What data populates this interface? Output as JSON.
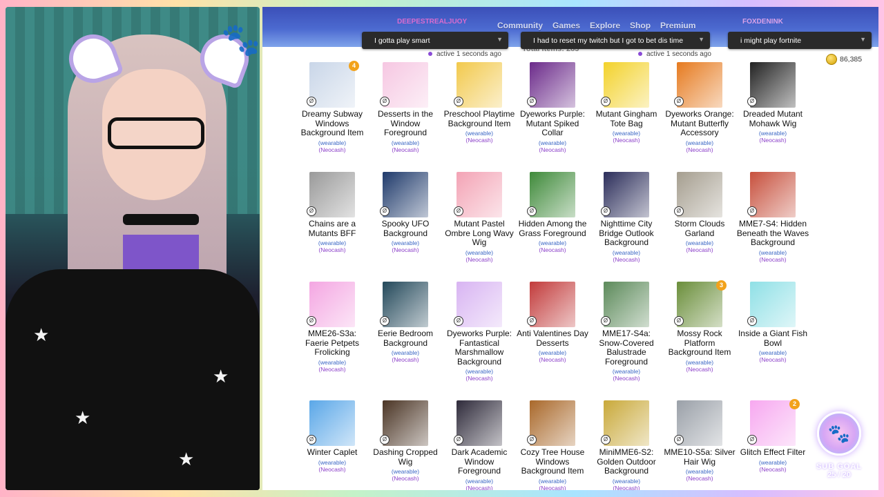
{
  "stream": {
    "chat": [
      {
        "text": "I gotta play smart",
        "active": "active 1 seconds ago"
      },
      {
        "text": "I had to reset my twitch but I got to bet dis time",
        "active": "active 1 seconds ago"
      },
      {
        "text": "i might play fortnite",
        "active": ""
      }
    ],
    "sub_goal": {
      "label": "SUB GOAL",
      "count": "25 / 20"
    }
  },
  "site": {
    "nav": [
      "Community",
      "Games",
      "Explore",
      "Shop",
      "Premium"
    ],
    "users": [
      "DEEPESTREALJUOY",
      "FOXDENINK"
    ],
    "total_items": "Total Items: 283",
    "currency": "86,385"
  },
  "items": [
    {
      "name": "Dreamy Subway Windows Background Item",
      "qty": "4",
      "color": "#c9d6e8"
    },
    {
      "name": "Desserts in the Window Foreground",
      "qty": "",
      "color": "#f6c7e2"
    },
    {
      "name": "Preschool Playtime Background Item",
      "qty": "",
      "color": "#f2c94c"
    },
    {
      "name": "Dyeworks Purple: Mutant Spiked Collar",
      "qty": "",
      "color": "#6b2a8a"
    },
    {
      "name": "Mutant Gingham Tote Bag",
      "qty": "",
      "color": "#f3d22b"
    },
    {
      "name": "Dyeworks Orange: Mutant Butterfly Accessory",
      "qty": "",
      "color": "#e67a1f"
    },
    {
      "name": "Dreaded Mutant Mohawk Wig",
      "qty": "",
      "color": "#222222"
    },
    {
      "name": "Chains are a Mutants BFF",
      "qty": "",
      "color": "#9a9a9a"
    },
    {
      "name": "Spooky UFO Background",
      "qty": "",
      "color": "#1f3a6b"
    },
    {
      "name": "Mutant Pastel Ombre Long Wavy Wig",
      "qty": "",
      "color": "#f3a3b5"
    },
    {
      "name": "Hidden Among the Grass Foreground",
      "qty": "",
      "color": "#3f8a3a"
    },
    {
      "name": "Nighttime City Bridge Outlook Background",
      "qty": "",
      "color": "#2b2d5a"
    },
    {
      "name": "Storm Clouds Garland",
      "qty": "",
      "color": "#a59e8f"
    },
    {
      "name": "MME7-S4: Hidden Beneath the Waves Background",
      "qty": "",
      "color": "#c7503d"
    },
    {
      "name": "MME26-S3a: Faerie Petpets Frolicking",
      "qty": "",
      "color": "#f4a6e2"
    },
    {
      "name": "Eerie Bedroom Background",
      "qty": "",
      "color": "#23485a"
    },
    {
      "name": "Dyeworks Purple: Fantastical Marshmallow Background",
      "qty": "",
      "color": "#d8b4f2"
    },
    {
      "name": "Anti Valentines Day Desserts",
      "qty": "",
      "color": "#c23b3b"
    },
    {
      "name": "MME17-S4a: Snow-Covered Balustrade Foreground",
      "qty": "",
      "color": "#5c8a5a"
    },
    {
      "name": "Mossy Rock Platform Background Item",
      "qty": "3",
      "color": "#6a8e3a"
    },
    {
      "name": "Inside a Giant Fish Bowl",
      "qty": "",
      "color": "#8fe0e6"
    },
    {
      "name": "Winter Caplet",
      "qty": "",
      "color": "#5aa7e8"
    },
    {
      "name": "Dashing Cropped Wig",
      "qty": "",
      "color": "#4a3424"
    },
    {
      "name": "Dark Academic Window Foreground",
      "qty": "",
      "color": "#2e2a3a"
    },
    {
      "name": "Cozy Tree House Windows Background Item",
      "qty": "",
      "color": "#a9682a"
    },
    {
      "name": "MiniMME6-S2: Golden Outdoor Background",
      "qty": "",
      "color": "#c9a93a"
    },
    {
      "name": "MME10-S5a: Silver Hair Wig",
      "qty": "",
      "color": "#9aa0a8"
    },
    {
      "name": "Glitch Effect Filter",
      "qty": "2",
      "color": "#f7a8f0"
    }
  ],
  "labels": {
    "wearable": "(wearable)",
    "neocash": "(Neocash)"
  }
}
